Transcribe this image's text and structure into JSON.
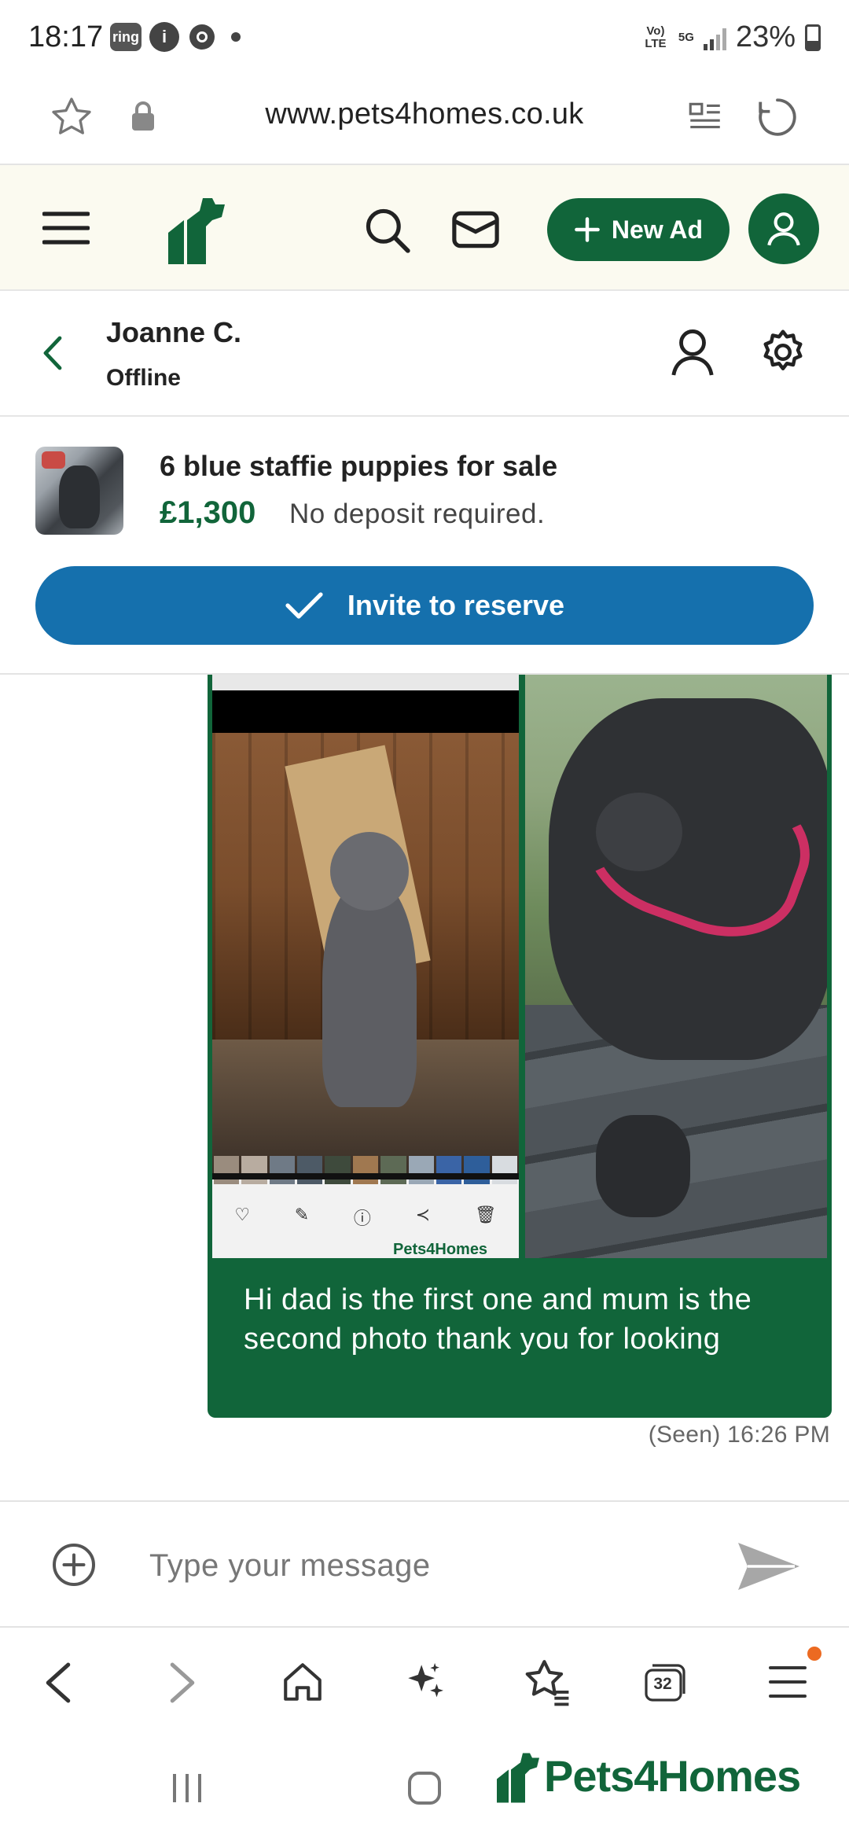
{
  "status_bar": {
    "time": "18:17",
    "notif_ring": "ring",
    "notif_info": "i",
    "volte_label": "Vo) LTE",
    "net_label": "5G",
    "battery": "23%"
  },
  "browser": {
    "url": "www.pets4homes.co.uk",
    "tab_count": "32"
  },
  "site_header": {
    "new_ad_label": "New Ad"
  },
  "chat_header": {
    "contact_name": "Joanne C.",
    "contact_status": "Offline"
  },
  "listing": {
    "title": "6 blue staffie puppies for sale",
    "price": "£1,300",
    "note": "No deposit required.",
    "invite_label": "Invite to reserve"
  },
  "message": {
    "text": "Hi dad is the first one and mum is the second photo thank you for looking",
    "meta": "(Seen) 16:26 PM",
    "embedded_logo": "Pets4Homes"
  },
  "composer": {
    "placeholder": "Type your message"
  },
  "brand": {
    "name": "Pets4Homes"
  },
  "colors": {
    "brand_green": "#11653a",
    "invite_blue": "#1570ad",
    "header_bg": "#fbfaf0",
    "notification_orange": "#ec6a21"
  },
  "icons": [
    "star-icon",
    "lock-icon",
    "reader-icon",
    "reload-icon",
    "menu-icon",
    "search-icon",
    "mail-icon",
    "plus-icon",
    "user-icon",
    "back-icon",
    "profile-icon",
    "gear-icon",
    "check-icon",
    "add-circle-icon",
    "send-icon",
    "home-icon",
    "sparkle-icon",
    "bookmarks-icon",
    "tabs-icon"
  ]
}
